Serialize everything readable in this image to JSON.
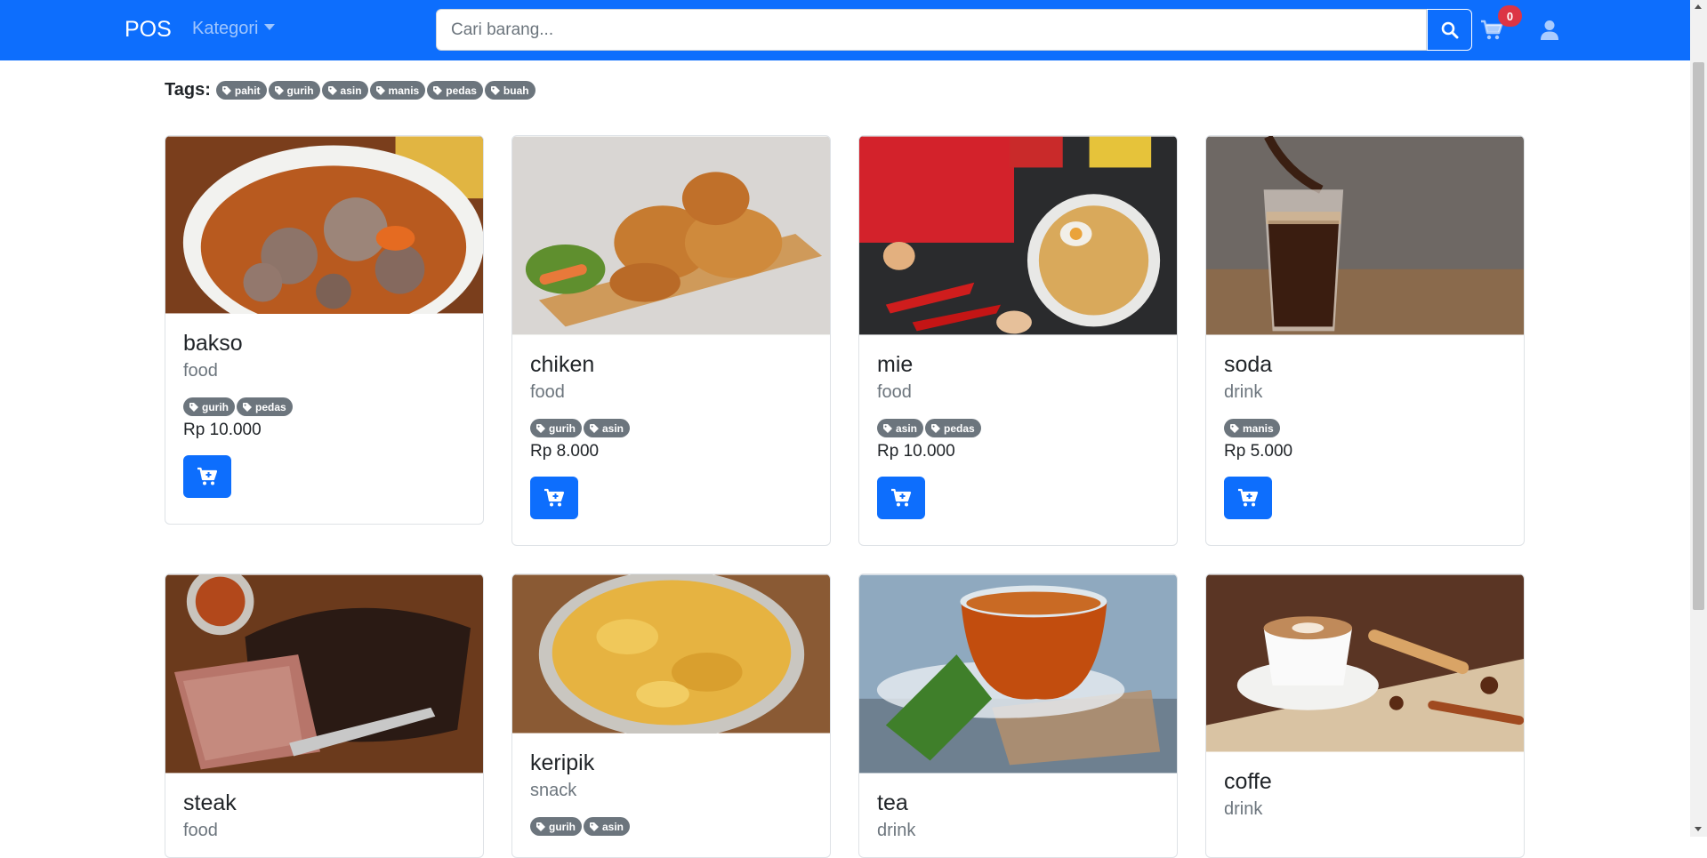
{
  "navbar": {
    "brand": "POS",
    "kategori_label": "Kategori",
    "search_placeholder": "Cari barang...",
    "cart_count": "0",
    "icons": [
      "search-icon",
      "cart-icon",
      "user-icon",
      "tag-icon",
      "cart-plus-icon"
    ]
  },
  "tags_title": "Tags:",
  "tags": [
    "pahit",
    "gurih",
    "asin",
    "manis",
    "pedas",
    "buah"
  ],
  "products": [
    {
      "name": "bakso",
      "category": "food",
      "tags": [
        "gurih",
        "pedas"
      ],
      "price": "Rp 10.000"
    },
    {
      "name": "chiken",
      "category": "food",
      "tags": [
        "gurih",
        "asin"
      ],
      "price": "Rp 8.000"
    },
    {
      "name": "mie",
      "category": "food",
      "tags": [
        "asin",
        "pedas"
      ],
      "price": "Rp 10.000"
    },
    {
      "name": "soda",
      "category": "drink",
      "tags": [
        "manis"
      ],
      "price": "Rp 5.000"
    },
    {
      "name": "steak",
      "category": "food"
    },
    {
      "name": "keripik",
      "category": "snack",
      "tags": [
        "gurih",
        "asin"
      ]
    },
    {
      "name": "tea",
      "category": "drink"
    },
    {
      "name": "coffe",
      "category": "drink"
    }
  ],
  "colors": {
    "primary": "#0d6efd",
    "badge": "#6c757d",
    "danger": "#dc3545"
  }
}
